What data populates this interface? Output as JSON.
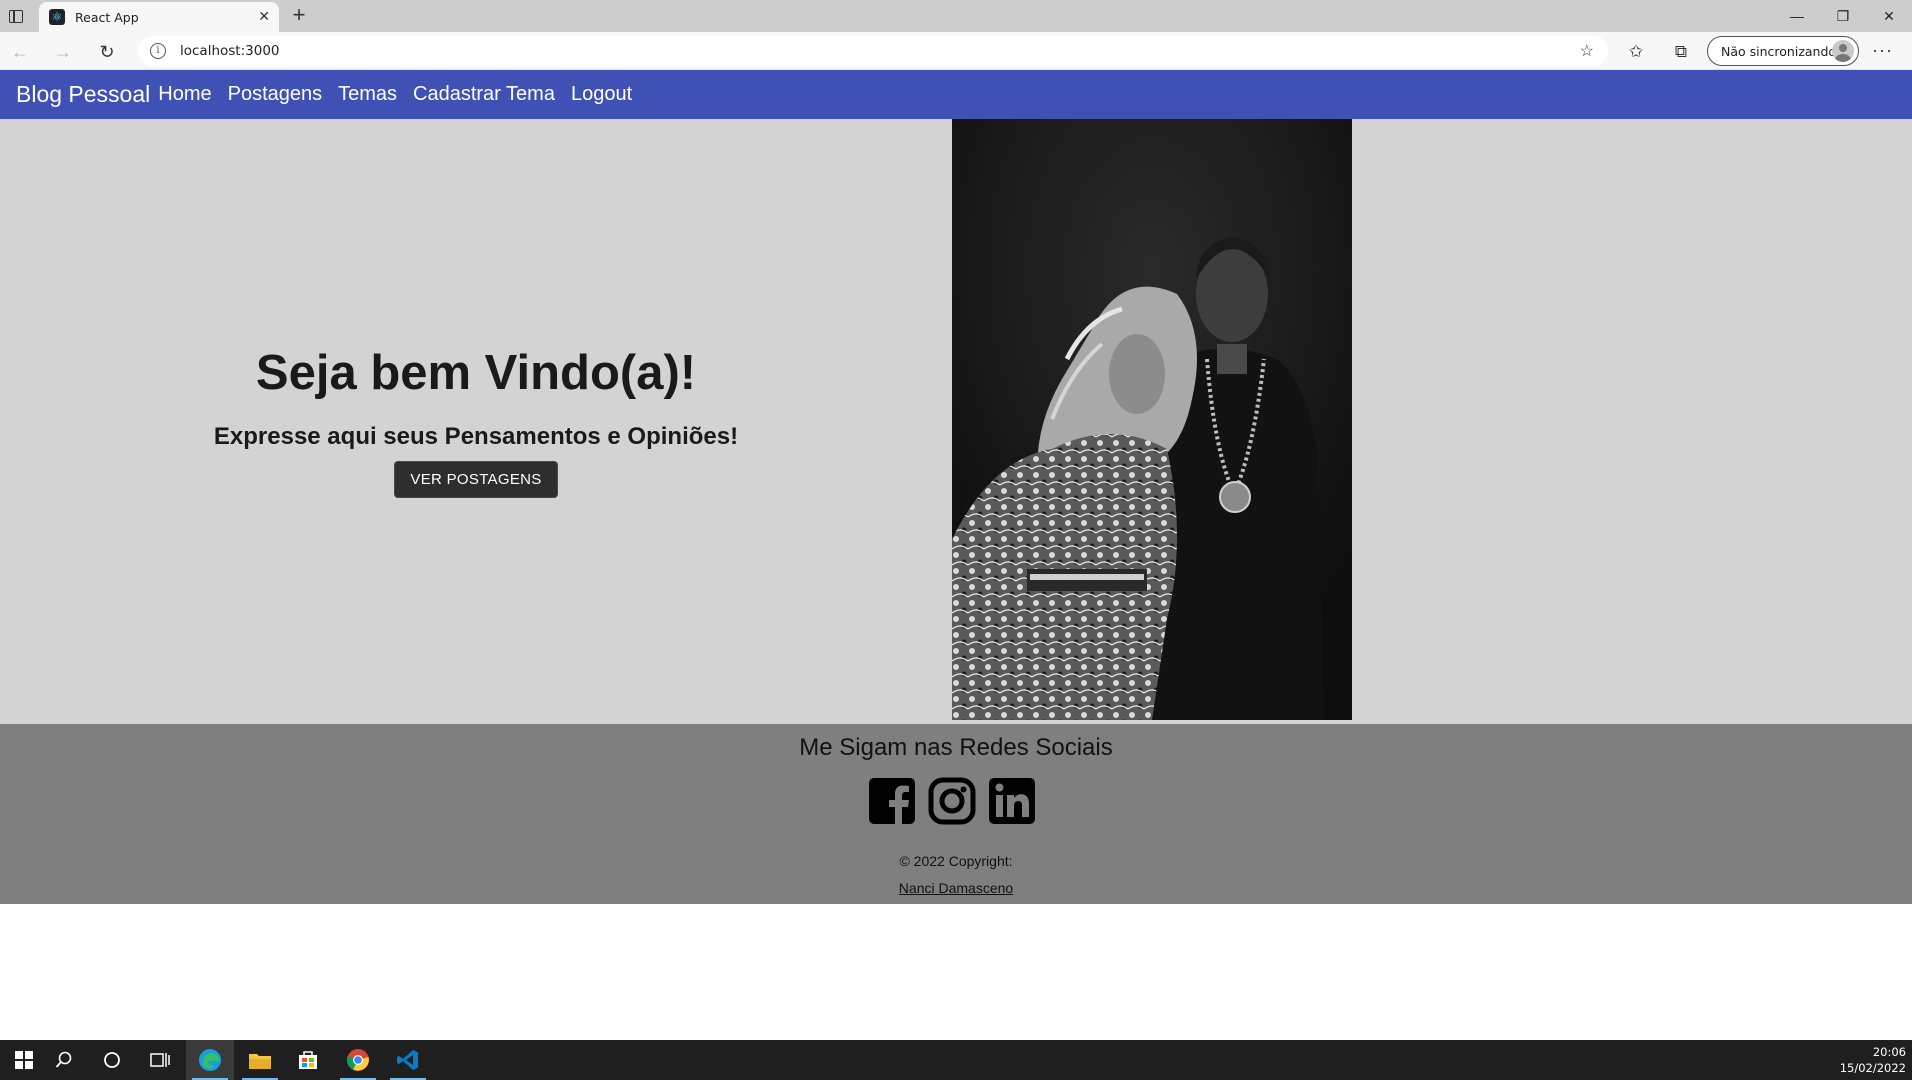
{
  "browser": {
    "tab_title": "React App",
    "url": "localhost:3000",
    "profile_label": "Não sincronizando"
  },
  "nav": {
    "brand": "Blog Pessoal",
    "links": [
      "Home",
      "Postagens",
      "Temas",
      "Cadastrar Tema",
      "Logout"
    ]
  },
  "hero": {
    "title": "Seja bem Vindo(a)!",
    "subtitle": "Expresse aqui seus Pensamentos e Opiniões!",
    "button_label": "VER POSTAGENS"
  },
  "footer": {
    "title": "Me Sigam nas Redes Sociais",
    "social_icons": [
      "facebook-icon",
      "instagram-icon",
      "linkedin-icon"
    ],
    "copyright": "© 2022 Copyright:",
    "author": "Nanci Damasceno"
  },
  "taskbar": {
    "time": "20:06",
    "date": "15/02/2022"
  },
  "colors": {
    "appbar": "#3f51b5",
    "hero_bg": "#d3d3d3",
    "footer_bg": "#7f7f7f",
    "button_bg": "#2e2e2e"
  }
}
